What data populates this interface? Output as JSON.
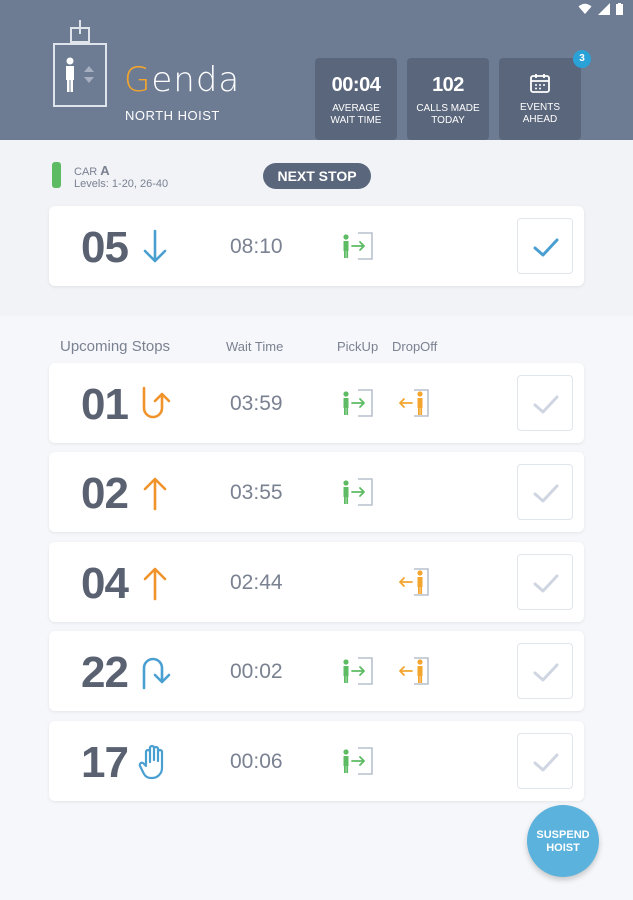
{
  "header": {
    "logo_g": "G",
    "logo_rest": "enda",
    "subtitle": "NORTH HOIST"
  },
  "stats": [
    {
      "value": "00:04",
      "label_line1": "AVERAGE",
      "label_line2": "WAIT TIME"
    },
    {
      "value": "102",
      "label_line1": "CALLS MADE",
      "label_line2": "TODAY"
    },
    {
      "value": "",
      "label_line1": "EVENTS",
      "label_line2": "AHEAD",
      "badge": "3",
      "icon": "calendar-icon"
    }
  ],
  "car": {
    "label": "CAR",
    "letter": "A",
    "levels": "Levels:  1-20, 26-40"
  },
  "next_stop": {
    "label": "NEXT STOP",
    "floor": "05",
    "direction": "down",
    "wait": "08:10",
    "pickup": true,
    "dropoff": false,
    "confirmed": true
  },
  "columns": {
    "upcoming": "Upcoming Stops",
    "wait": "Wait Time",
    "pickup": "PickUp",
    "dropoff": "DropOff"
  },
  "upcoming": [
    {
      "floor": "01",
      "direction": "uturn-up",
      "wait": "03:59",
      "pickup": true,
      "dropoff": true
    },
    {
      "floor": "02",
      "direction": "up",
      "wait": "03:55",
      "pickup": true,
      "dropoff": false
    },
    {
      "floor": "04",
      "direction": "up",
      "wait": "02:44",
      "pickup": false,
      "dropoff": true
    },
    {
      "floor": "22",
      "direction": "uturn-down",
      "wait": "00:02",
      "pickup": true,
      "dropoff": true
    },
    {
      "floor": "17",
      "direction": "stop-hand",
      "wait": "00:06",
      "pickup": true,
      "dropoff": false
    }
  ],
  "suspend": {
    "line1": "SUSPEND",
    "line2": "HOIST"
  },
  "colors": {
    "header": "#6d7b93",
    "tile": "#5a667b",
    "pickup_green": "#5dbb63",
    "dropoff_orange": "#f3a52e",
    "arrow_blue": "#4a9fd1",
    "arrow_orange": "#f0932b",
    "suspend_blue": "#5bb2dc"
  }
}
